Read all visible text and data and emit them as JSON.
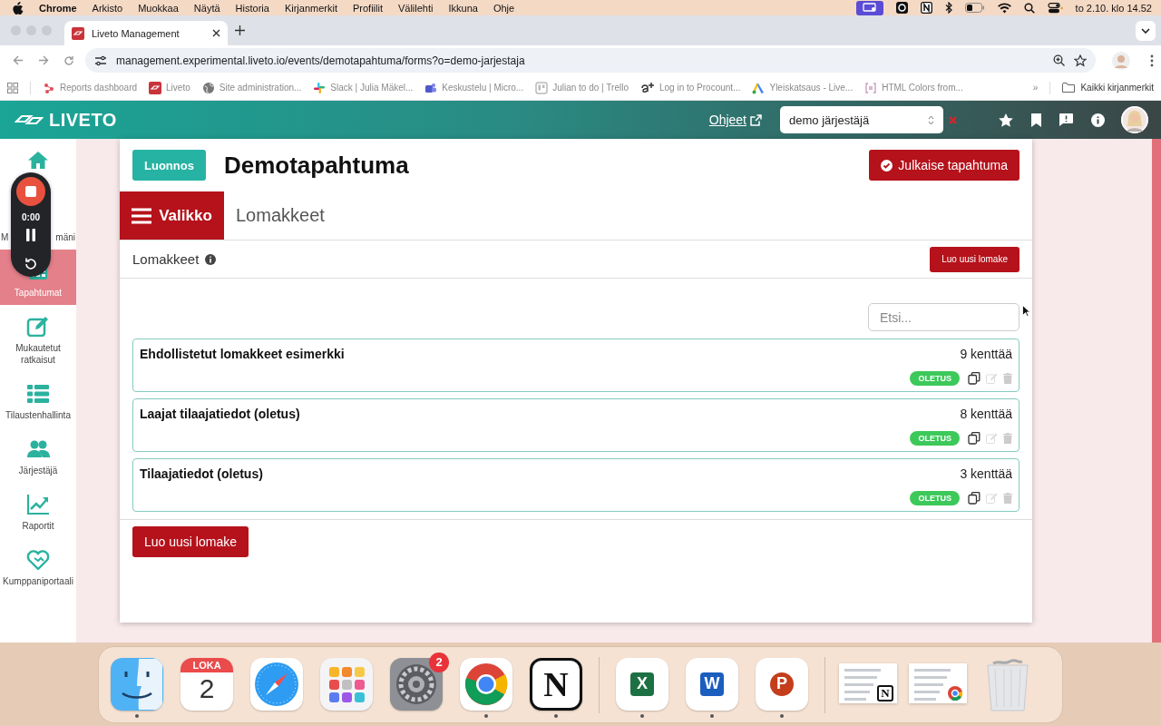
{
  "menubar": {
    "app": "Chrome",
    "menus": [
      "Arkisto",
      "Muokkaa",
      "Näytä",
      "Historia",
      "Kirjanmerkit",
      "Profiilit",
      "Välilehti",
      "Ikkuna",
      "Ohje"
    ],
    "clock": "to 2.10. klo 14.52"
  },
  "browser": {
    "tabs": [
      {
        "title": "Liveto Management",
        "selected": true
      }
    ],
    "url": "management.experimental.liveto.io/events/demotapahtuma/forms?o=demo-jarjestaja",
    "bookmarks": [
      {
        "label": "Reports dashboard"
      },
      {
        "label": "Liveto"
      },
      {
        "label": "Site administration..."
      },
      {
        "label": "Slack | Julia Mäkel..."
      },
      {
        "label": "Keskustelu | Micro..."
      },
      {
        "label": "Julian to do | Trello"
      },
      {
        "label": "Log in to Procount..."
      },
      {
        "label": "Yleiskatsaus - Live..."
      },
      {
        "label": "HTML Colors from..."
      }
    ],
    "more": "»",
    "all_bookmarks": "Kaikki kirjanmerkit"
  },
  "app": {
    "logo": "LIVETO",
    "help_link": "Ohjeet",
    "organizer": "demo järjestäjä",
    "sidebar": [
      {
        "selected": false
      },
      {
        "label_parts": [
          "M",
          "mäni"
        ],
        "selected": false
      },
      {
        "label": "Tapahtumat",
        "selected": true
      },
      {
        "label": "Mukautetut ratkaisut",
        "selected": false
      },
      {
        "label": "Tilaustenhallinta",
        "selected": false
      },
      {
        "label": "Järjestäjä",
        "selected": false
      },
      {
        "label": "Raportit",
        "selected": false
      },
      {
        "label": "Kumppaniportaali",
        "selected": false
      }
    ],
    "event": {
      "status": "Luonnos",
      "title": "Demotapahtuma",
      "publish": "Julkaise tapahtuma"
    },
    "menu_button": "Valikko",
    "section": "Lomakkeet",
    "panel": {
      "title": "Lomakkeet",
      "new_button": "Luo uusi lomake",
      "search": {
        "placeholder": "Etsi..."
      },
      "forms": [
        {
          "name": "Ehdollistetut lomakkeet esimerkki",
          "fields": "9 kenttää",
          "badge": "OLETUS"
        },
        {
          "name": "Laajat tilaajatiedot (oletus)",
          "fields": "8 kenttää",
          "badge": "OLETUS"
        },
        {
          "name": "Tilaajatiedot (oletus)",
          "fields": "3 kenttää",
          "badge": "OLETUS"
        }
      ],
      "footer_button": "Luo uusi lomake"
    }
  },
  "recorder": {
    "time": "0:00"
  },
  "dock": {
    "apps": [
      {
        "kind": "finder",
        "running": true
      },
      {
        "kind": "calendar",
        "month": "LOKA",
        "day": "2",
        "running": false
      },
      {
        "kind": "safari",
        "running": false
      },
      {
        "kind": "launchpad",
        "running": false
      },
      {
        "kind": "settings",
        "badge": "2",
        "running": false
      },
      {
        "kind": "chrome",
        "running": true
      },
      {
        "kind": "notion",
        "glyph": "N",
        "running": true
      },
      {
        "kind": "separator"
      },
      {
        "kind": "excel",
        "glyph": "X",
        "running": true
      },
      {
        "kind": "word",
        "glyph": "W",
        "running": true
      },
      {
        "kind": "powerpoint",
        "glyph": "P",
        "running": true
      },
      {
        "kind": "separator"
      },
      {
        "kind": "window",
        "glyph": "N"
      },
      {
        "kind": "window"
      },
      {
        "kind": "trash"
      }
    ]
  }
}
